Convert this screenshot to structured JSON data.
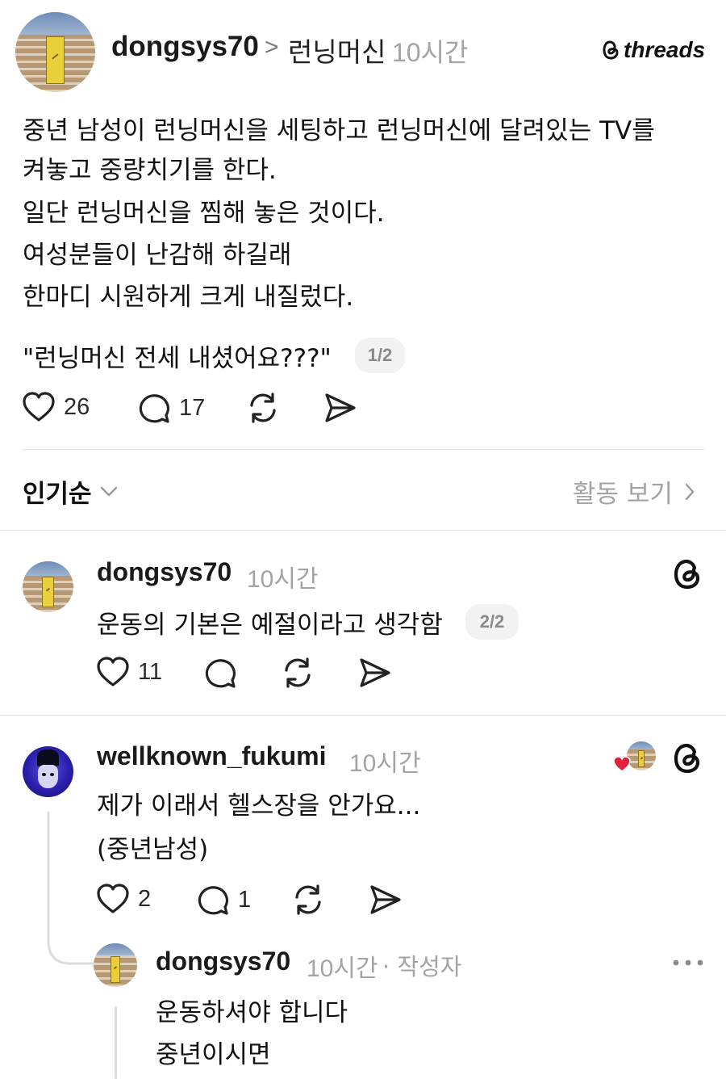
{
  "post": {
    "username": "dongsys70",
    "separator": ">",
    "topic": "런닝머신",
    "time": "10시간",
    "brand": "threads",
    "lines": [
      "중년 남성이 런닝머신을 세팅하고 런닝머신에 달려있는 TV를",
      "켜놓고 중량치기를 한다.",
      "일단 런닝머신을 찜해 놓은 것이다.",
      "여성분들이 난감해 하길래",
      "한마디 시원하게 크게 내질렀다."
    ],
    "quote": "\"런닝머신 전세 내셨어요???\"",
    "page_badge": "1/2",
    "likes": "26",
    "comments": "17"
  },
  "sort": {
    "label": "인기순",
    "activity_label": "활동 보기"
  },
  "replies": [
    {
      "username": "dongsys70",
      "time": "10시간",
      "text": "운동의 기본은 예절이라고 생각함",
      "page_badge": "2/2",
      "likes": "11",
      "comments": ""
    },
    {
      "username": "wellknown_fukumi",
      "time": "10시간",
      "lines": [
        "제가 이래서 헬스장을 안가요...",
        "(중년남성)"
      ],
      "likes": "2",
      "comments": "1"
    },
    {
      "username": "dongsys70",
      "time": "10시간",
      "author_tag": "· 작성자",
      "lines": [
        "운동하셔야 합니다",
        "중년이시면"
      ]
    }
  ],
  "colors": {
    "heart_red": "#e0213f",
    "muted": "#a3a3a3",
    "divider": "#e3e3e3"
  }
}
